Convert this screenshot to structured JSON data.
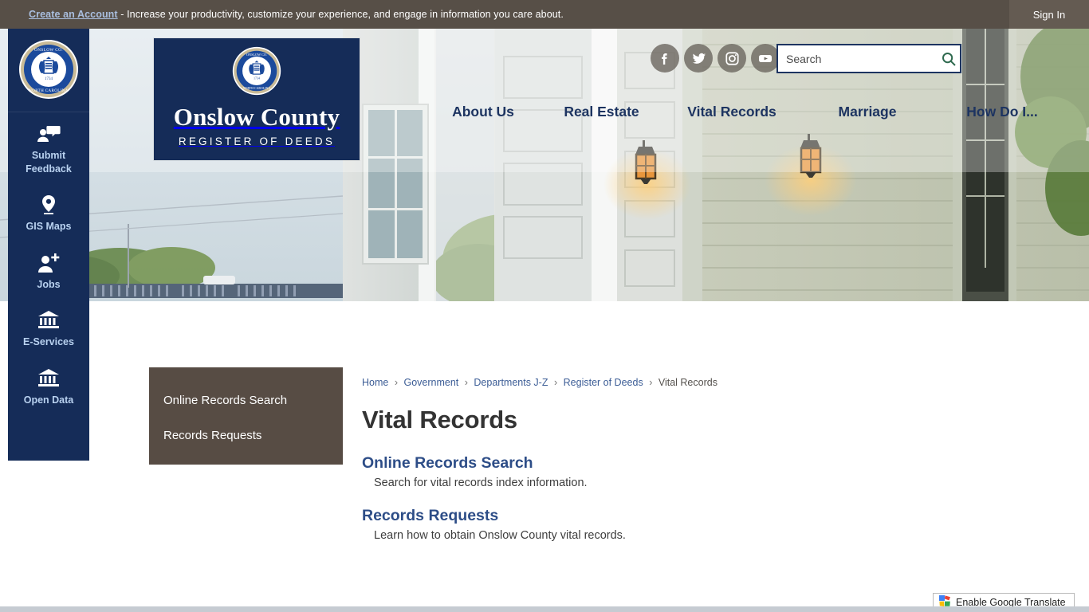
{
  "topbar": {
    "account_link": "Create an Account",
    "message": " - Increase your productivity, customize your experience, and engage in information you care about.",
    "sign_in": "Sign In"
  },
  "logo": {
    "title": "Onslow County",
    "subtitle": "REGISTER OF DEEDS",
    "seal_top_text": "ONSLOW COUNTY",
    "seal_bottom_text": "NORTH CAROLINA",
    "seal_year": "1734"
  },
  "rail": {
    "items": [
      {
        "label": "Submit Feedback",
        "icon": "feedback-icon"
      },
      {
        "label": "GIS Maps",
        "icon": "map-pin-icon"
      },
      {
        "label": "Jobs",
        "icon": "person-add-icon"
      },
      {
        "label": "E-Services",
        "icon": "bank-icon"
      },
      {
        "label": "Open Data",
        "icon": "bank-icon"
      }
    ]
  },
  "social": [
    {
      "name": "facebook",
      "label": "Facebook"
    },
    {
      "name": "twitter",
      "label": "Twitter"
    },
    {
      "name": "instagram",
      "label": "Instagram"
    },
    {
      "name": "youtube",
      "label": "YouTube"
    }
  ],
  "search": {
    "placeholder": "Search",
    "value": ""
  },
  "nav": [
    {
      "label": "About Us"
    },
    {
      "label": "Real Estate"
    },
    {
      "label": "Vital Records"
    },
    {
      "label": "Marriage"
    },
    {
      "label": "How Do I..."
    }
  ],
  "left_menu": {
    "items": [
      {
        "label": "Online Records Search"
      },
      {
        "label": "Records Requests"
      }
    ]
  },
  "breadcrumb": {
    "items": [
      "Home",
      "Government",
      "Departments J-Z",
      "Register of Deeds"
    ],
    "current": "Vital Records",
    "separator": "›"
  },
  "page": {
    "title": "Vital Records",
    "sections": [
      {
        "link": "Online Records Search",
        "description": "Search for vital records index information."
      },
      {
        "link": "Records Requests",
        "description": "Learn how to obtain Onslow County vital records."
      }
    ]
  },
  "translate": {
    "label": "Enable Google Translate"
  },
  "colors": {
    "navy": "#152c58",
    "topbar_brown": "#574f47",
    "menu_brown": "#574c44",
    "link_blue": "#2d4d87",
    "rail_label": "#b9d2f0",
    "search_icon_green": "#2f6a4f"
  }
}
